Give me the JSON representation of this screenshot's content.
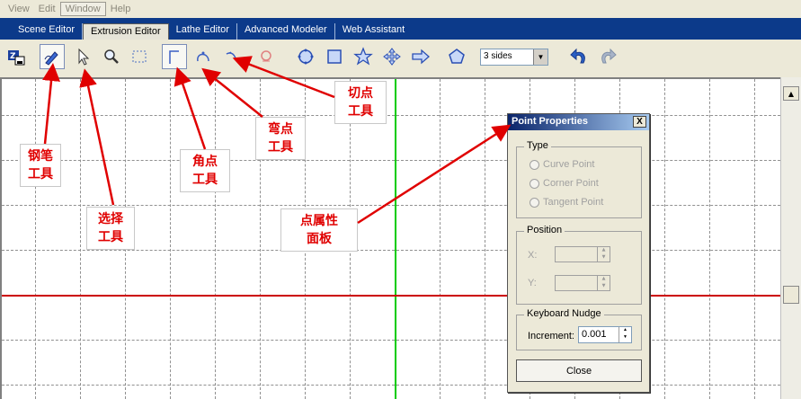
{
  "menubar": {
    "items": [
      {
        "label": "View"
      },
      {
        "label": "Edit"
      },
      {
        "label": "Window"
      },
      {
        "label": "Help"
      }
    ]
  },
  "tabs": [
    {
      "label": "Scene Editor"
    },
    {
      "label": "Extrusion Editor"
    },
    {
      "label": "Lathe Editor"
    },
    {
      "label": "Advanced Modeler"
    },
    {
      "label": "Web Assistant"
    }
  ],
  "toolbar": {
    "sides_select": "3 sides",
    "tools": [
      {
        "name": "save-icon"
      },
      {
        "name": "pen-tool-icon"
      },
      {
        "name": "select-arrow-icon"
      },
      {
        "name": "zoom-icon"
      },
      {
        "name": "marquee-icon"
      },
      {
        "name": "corner-point-icon"
      },
      {
        "name": "curve-point-icon"
      },
      {
        "name": "tangent-point-icon"
      },
      {
        "name": "delete-point-icon"
      },
      {
        "name": "circle-icon"
      },
      {
        "name": "square-icon"
      },
      {
        "name": "star-icon"
      },
      {
        "name": "cross-arrows-icon"
      },
      {
        "name": "arrow-icon"
      },
      {
        "name": "polygon-icon"
      },
      {
        "name": "undo-icon"
      },
      {
        "name": "redo-icon"
      }
    ]
  },
  "colors": {
    "tabbar_bg": "#0c3a8a",
    "x_axis": "#cc0000",
    "y_axis": "#00cc00",
    "annotation_text": "#e00000"
  },
  "panel": {
    "title": "Point Properties",
    "close_x": "X",
    "type_group": "Type",
    "type_options": [
      "Curve Point",
      "Corner Point",
      "Tangent Point"
    ],
    "position_group": "Position",
    "x_label": "X:",
    "y_label": "Y:",
    "nudge_group": "Keyboard Nudge",
    "increment_label": "Increment:",
    "increment_value": "0.001",
    "close_button": "Close"
  },
  "annotations": {
    "pen_line1": "钢笔",
    "pen_line2": "工具",
    "select_line1": "选择",
    "select_line2": "工具",
    "corner_line1": "角点",
    "corner_line2": "工具",
    "curve_line1": "弯点",
    "curve_line2": "工具",
    "tangent_line1": "切点",
    "tangent_line2": "工具",
    "panel_line1": "点属性",
    "panel_line2": "面板"
  }
}
